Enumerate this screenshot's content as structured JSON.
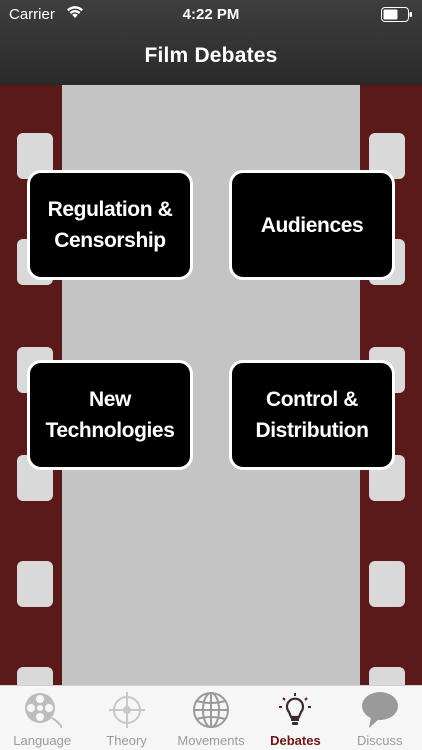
{
  "status_bar": {
    "carrier": "Carrier",
    "time": "4:22 PM"
  },
  "nav": {
    "title": "Film Debates"
  },
  "tiles": [
    {
      "label": "Regulation &\nCensorship"
    },
    {
      "label": "Audiences"
    },
    {
      "label": "New\nTechnologies"
    },
    {
      "label": "Control &\nDistribution"
    }
  ],
  "tabs": [
    {
      "label": "Language",
      "icon": "film-reel-icon"
    },
    {
      "label": "Theory",
      "icon": "crosshair-icon"
    },
    {
      "label": "Movements",
      "icon": "globe-icon"
    },
    {
      "label": "Debates",
      "icon": "lightbulb-icon",
      "active": true
    },
    {
      "label": "Discuss",
      "icon": "speech-bubble-icon"
    }
  ],
  "colors": {
    "film_border": "#5a1a1a",
    "film_center": "#c4c4c4",
    "sprocket": "#d9d9d9",
    "tile_bg": "#000000",
    "active_tab": "#6b1818"
  }
}
